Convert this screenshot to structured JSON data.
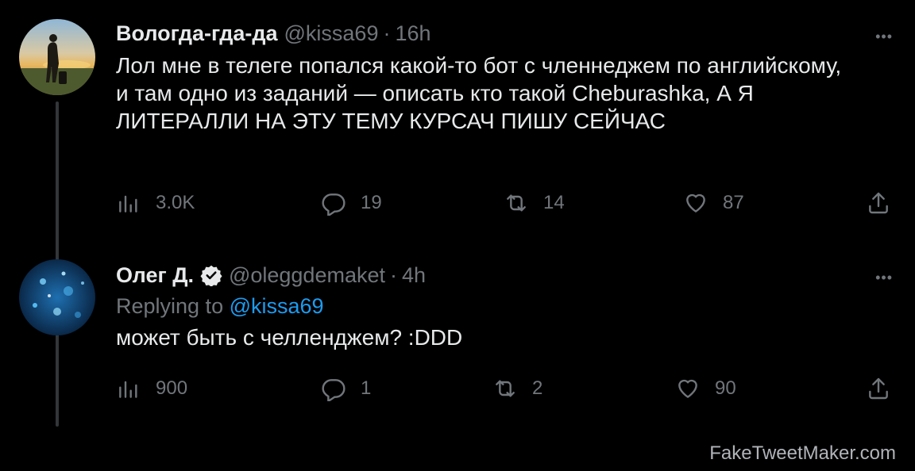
{
  "tweets": [
    {
      "name": "Вологда-гда-да",
      "handle": "@kissa69",
      "separator": "·",
      "time": "16h",
      "text": "Лол мне в телеге попался какой-то бот с членнеджем по английскому, и там одно из заданий — описать кто такой Cheburashka, А Я ЛИТЕРАЛЛИ НА ЭТУ ТЕМУ КУРСАЧ ПИШУ СЕЙЧАС",
      "more": "•••",
      "stats": {
        "views": "3.0K",
        "replies": "19",
        "retweets": "14",
        "likes": "87"
      }
    },
    {
      "name": "Олег Д.",
      "handle": "@oleggdemaket",
      "separator": "·",
      "time": "4h",
      "verified": true,
      "replying_prefix": "Replying to",
      "replying_handle": "@kissa69",
      "text": "может быть с челленджем? :DDD",
      "more": "•••",
      "stats": {
        "views": "900",
        "replies": "1",
        "retweets": "2",
        "likes": "90"
      }
    }
  ],
  "watermark": "FakeTweetMaker.com",
  "colors": {
    "background": "#000000",
    "text": "#e7e9ea",
    "muted": "#71767b",
    "link": "#1d9bf0"
  },
  "icons": [
    "views-icon",
    "reply-icon",
    "retweet-icon",
    "like-icon",
    "share-icon",
    "verified-badge-icon",
    "more-icon"
  ]
}
